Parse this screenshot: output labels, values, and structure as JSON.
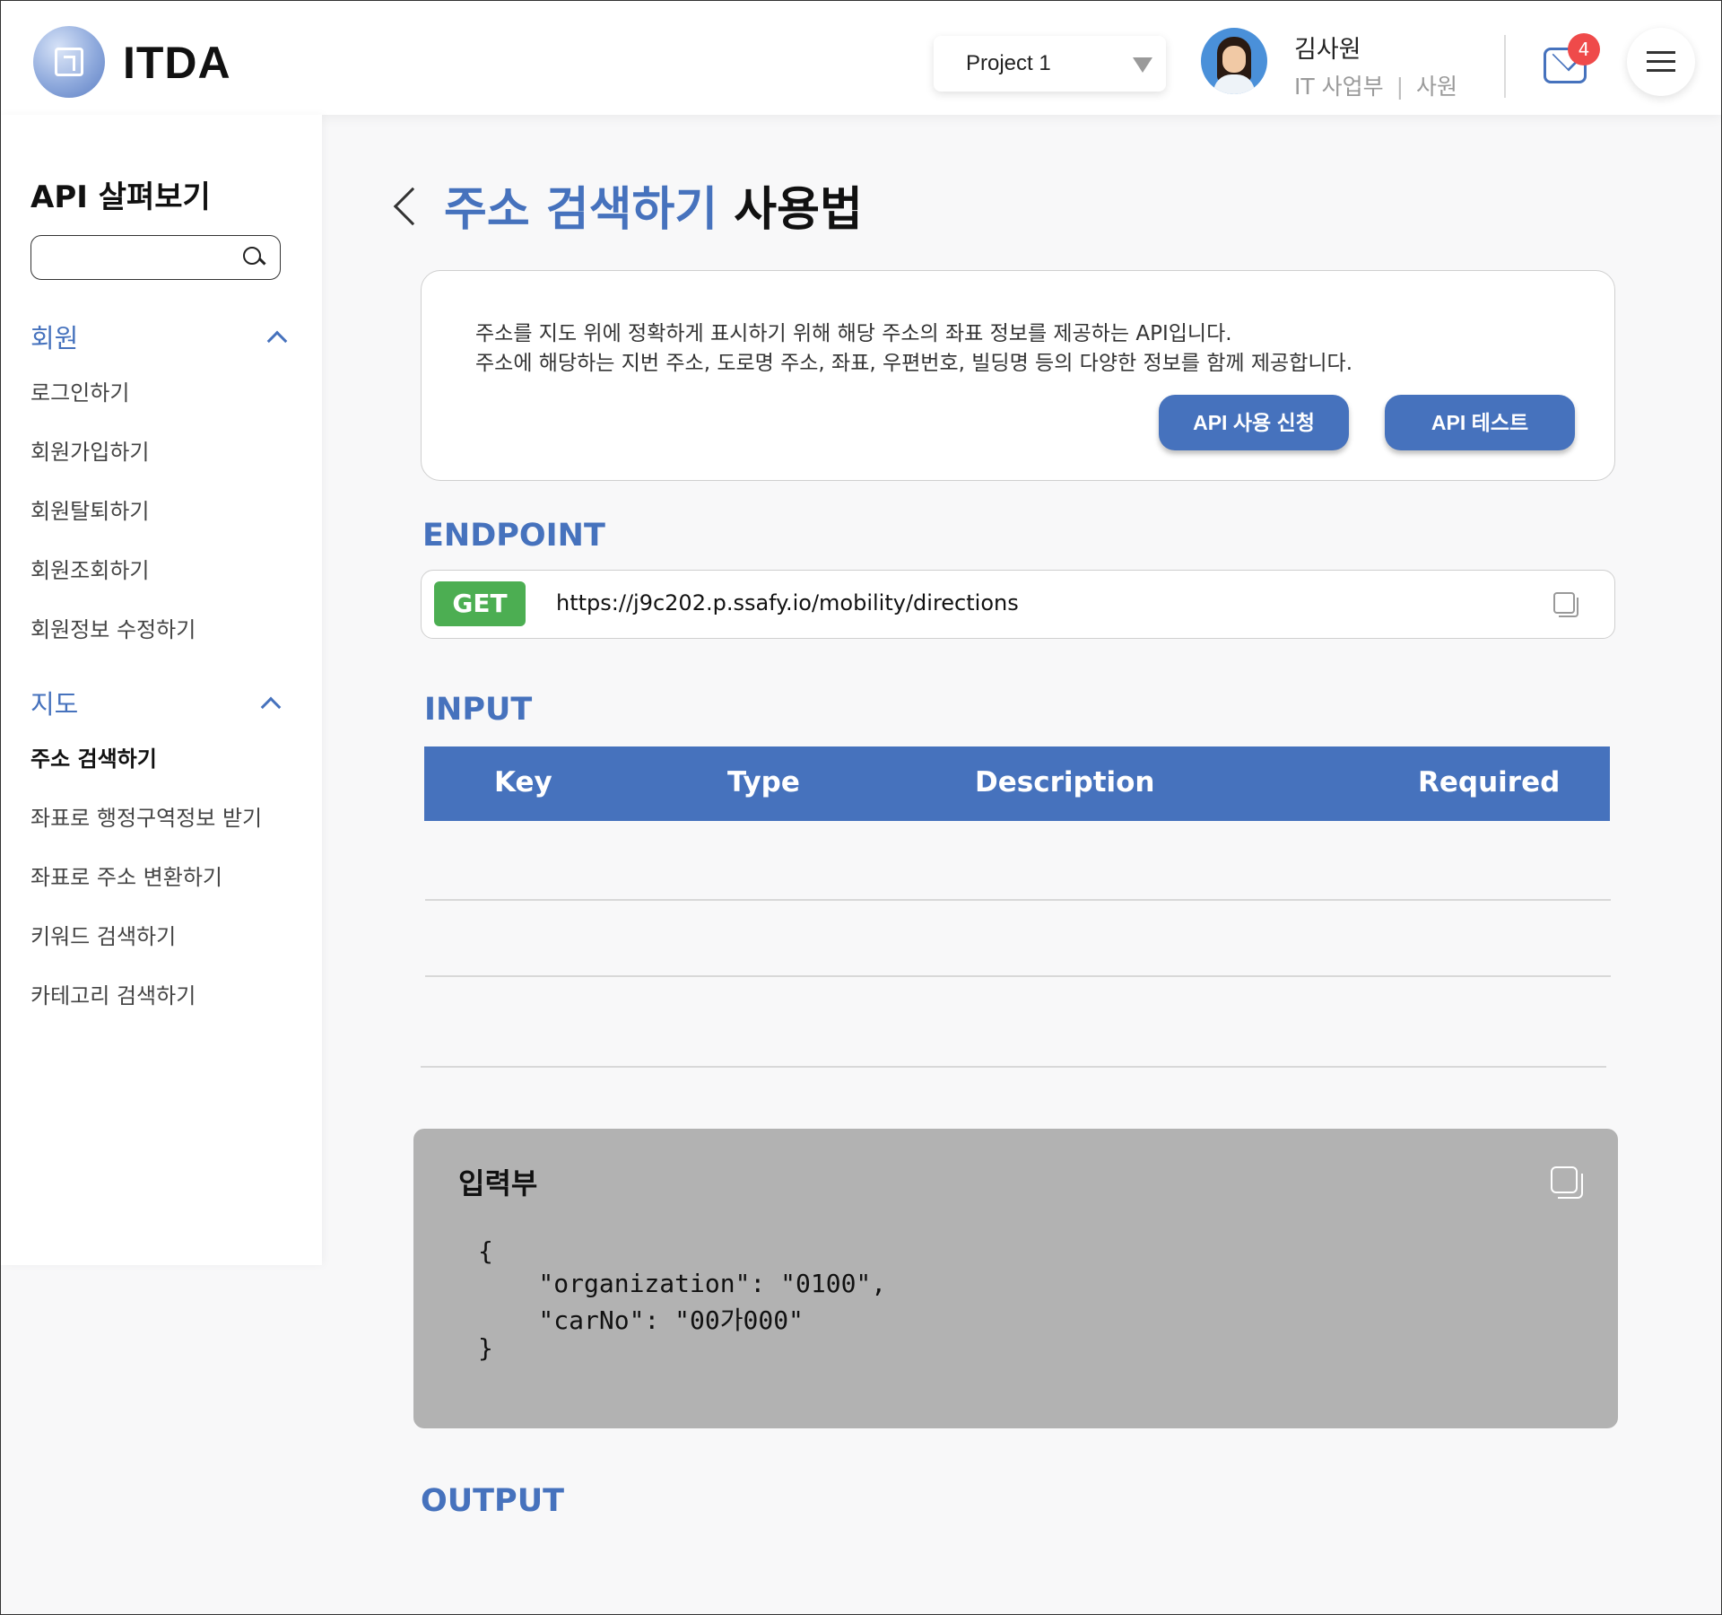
{
  "header": {
    "logo_text": "ITDA",
    "project_selected": "Project 1",
    "user_name": "김사원",
    "user_dept": "IT 사업부",
    "user_role": "사원",
    "separator": "|",
    "notification_count": "4"
  },
  "sidebar": {
    "title": "API 살펴보기",
    "search_placeholder": "",
    "groups": [
      {
        "title": "회원",
        "items": [
          "로그인하기",
          "회원가입하기",
          "회원탈퇴하기",
          "회원조회하기",
          "회원정보 수정하기"
        ]
      },
      {
        "title": "지도",
        "items": [
          "주소 검색하기",
          "좌표로 행정구역정보 받기",
          "좌표로 주소 변환하기",
          "키워드 검색하기",
          "카테고리 검색하기"
        ],
        "active_index": 0
      }
    ]
  },
  "main": {
    "title_highlight": "주소 검색하기",
    "title_suffix": "사용법",
    "description": [
      "주소를 지도 위에 정확하게 표시하기 위해 해당 주소의 좌표 정보를 제공하는 API입니다.",
      "주소에 해당하는 지번 주소, 도로명 주소, 좌표, 우편번호, 빌딩명 등의 다양한 정보를 함께 제공합니다."
    ],
    "apply_button": "API 사용 신청",
    "test_button": "API 테스트",
    "endpoint_section": "ENDPOINT",
    "endpoint_method": "GET",
    "endpoint_url": "https://j9c202.p.ssafy.io/mobility/directions",
    "input_section": "INPUT",
    "input_columns": [
      "Key",
      "Type",
      "Description",
      "Required"
    ],
    "code_title": "입력부",
    "code_lines": [
      "{",
      "    \"organization\": \"0100\",",
      "    \"carNo\": \"00가000\"",
      "}"
    ],
    "output_section": "OUTPUT"
  },
  "colors": {
    "accent": "#4672bd",
    "get_badge": "#4cae52",
    "badge_red": "#ef4a4a",
    "code_bg": "#b2b2b2"
  }
}
